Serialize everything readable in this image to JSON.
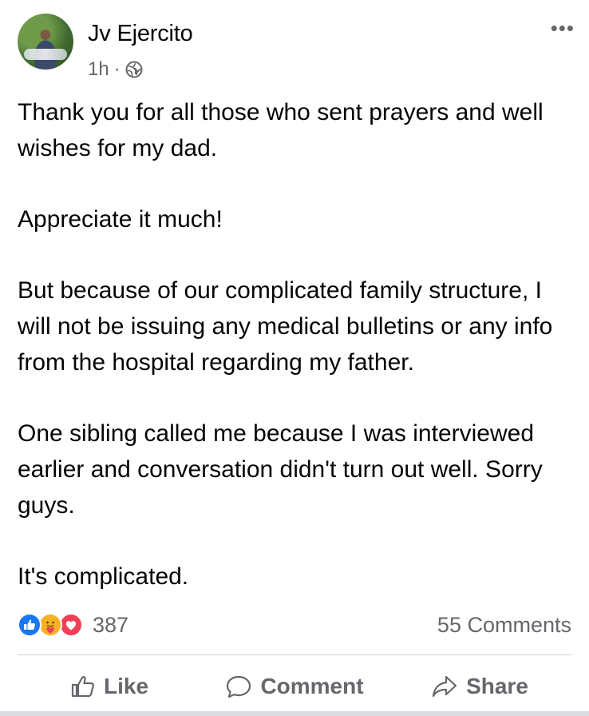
{
  "post": {
    "author": "Jv Ejercito",
    "time": "1h",
    "separator": "·",
    "privacy_icon": "globe-icon",
    "more_icon": "more-dots-icon",
    "more_label": "•••",
    "paragraphs": [
      "Thank you for all those who sent prayers and well wishes for my dad.",
      "Appreciate it much!",
      "But because of our complicated family structure, I will not be issuing any medical bulletins or any info from the hospital regarding my father.",
      "One sibling called me because I was interviewed earlier and conversation didn't turn out well. Sorry guys.",
      "It's complicated."
    ]
  },
  "stats": {
    "reactions": [
      "like-icon",
      "care-icon",
      "love-icon"
    ],
    "reaction_count": "387",
    "comments": "55 Comments"
  },
  "actions": {
    "like": "Like",
    "comment": "Comment",
    "share": "Share"
  },
  "colors": {
    "text": "#050505",
    "secondary": "#65676b",
    "like_blue": "#1877f2",
    "care_yellow": "#f7b125",
    "love_red": "#f33e58"
  }
}
